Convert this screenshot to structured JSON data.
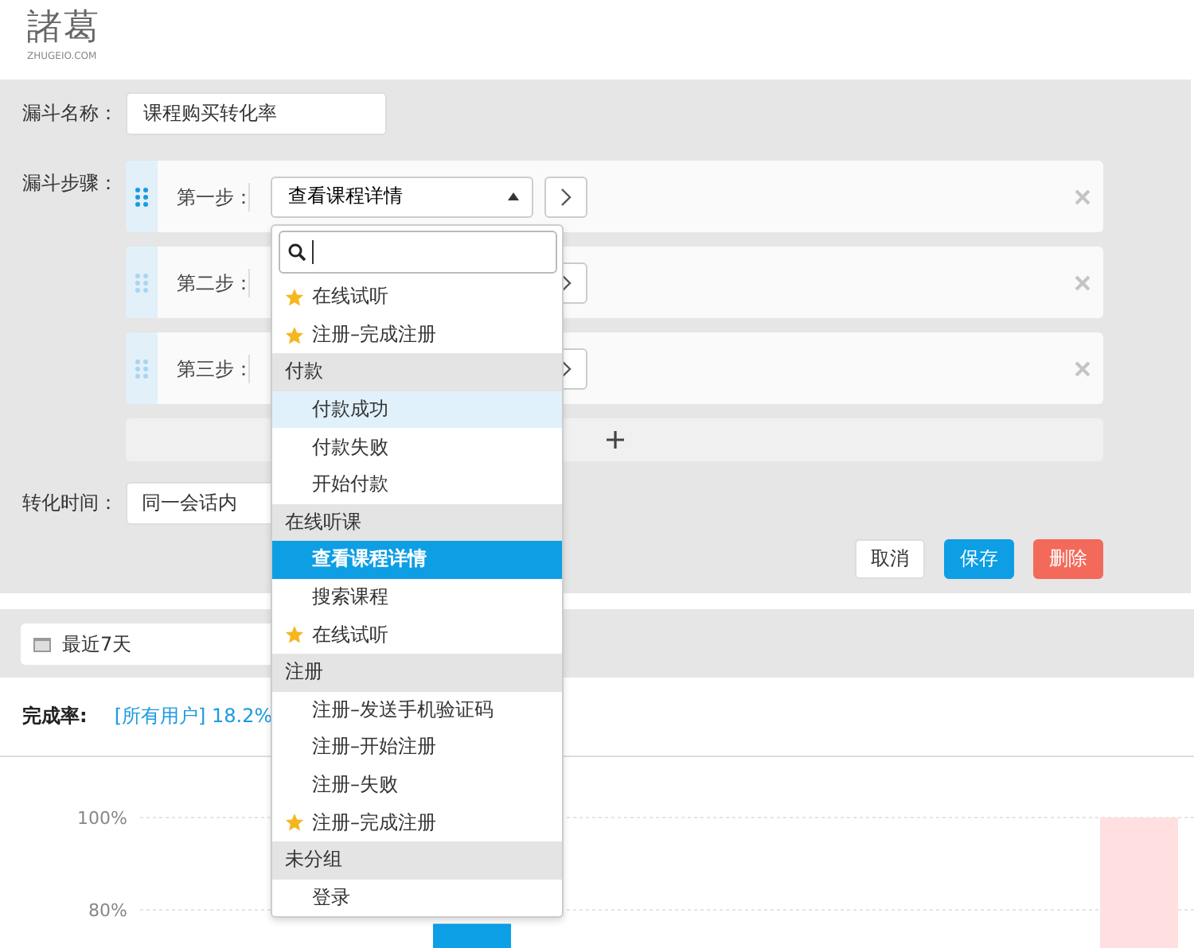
{
  "header": {
    "logo": "諸葛",
    "logo_caption": "ZHUGEIO.COM"
  },
  "form": {
    "name_label": "漏斗名称：",
    "name_value": "课程购买转化率",
    "steps_label": "漏斗步骤：",
    "steps": [
      {
        "label": "第一步：",
        "active": true,
        "value": "查看课程详情",
        "open": true
      },
      {
        "label": "第二步：",
        "active": false
      },
      {
        "label": "第三步：",
        "active": false
      }
    ],
    "time_label": "转化时间：",
    "time_value": "同一会话内",
    "buttons": [
      {
        "label": "取消",
        "kind": "default"
      },
      {
        "label": "保存",
        "kind": "primary"
      },
      {
        "label": "删除",
        "kind": "danger"
      }
    ]
  },
  "dropdown": {
    "items": [
      {
        "kind": "option",
        "label": "在线试听",
        "starred": true,
        "selected": false,
        "hovered": false
      },
      {
        "kind": "option",
        "label": "注册–完成注册",
        "starred": true,
        "selected": false,
        "hovered": false
      },
      {
        "kind": "group",
        "label": "付款"
      },
      {
        "kind": "option",
        "label": "付款成功",
        "starred": false,
        "selected": false,
        "hovered": true
      },
      {
        "kind": "option",
        "label": "付款失败",
        "starred": false,
        "selected": false,
        "hovered": false
      },
      {
        "kind": "option",
        "label": "开始付款",
        "starred": false,
        "selected": false,
        "hovered": false
      },
      {
        "kind": "group",
        "label": "在线听课"
      },
      {
        "kind": "option",
        "label": "查看课程详情",
        "starred": false,
        "selected": true,
        "hovered": false
      },
      {
        "kind": "option",
        "label": "搜索课程",
        "starred": false,
        "selected": false,
        "hovered": false
      },
      {
        "kind": "option",
        "label": "在线试听",
        "starred": true,
        "selected": false,
        "hovered": false
      },
      {
        "kind": "group",
        "label": "注册"
      },
      {
        "kind": "option",
        "label": "注册–发送手机验证码",
        "starred": false,
        "selected": false,
        "hovered": false
      },
      {
        "kind": "option",
        "label": "注册–开始注册",
        "starred": false,
        "selected": false,
        "hovered": false
      },
      {
        "kind": "option",
        "label": "注册–失败",
        "starred": false,
        "selected": false,
        "hovered": false
      },
      {
        "kind": "option",
        "label": "注册–完成注册",
        "starred": true,
        "selected": false,
        "hovered": false
      },
      {
        "kind": "group",
        "label": "未分组"
      },
      {
        "kind": "option",
        "label": "登录",
        "starred": false,
        "selected": false,
        "hovered": false
      }
    ]
  },
  "results": {
    "date_range": "最近7天",
    "rate_label": "完成率:",
    "rate_value": "[所有用户] 18.2%",
    "chart_data": {
      "type": "bar",
      "ylim": [
        71.4,
        100
      ],
      "yticks": [
        {
          "value": 100,
          "label": "100%"
        },
        {
          "value": 80,
          "label": "80%"
        }
      ],
      "series": [
        {
          "color": "#0ea0e6",
          "values": [
            77,
            null
          ]
        },
        {
          "color": "#ffdfe0",
          "values": [
            null,
            100
          ]
        }
      ]
    }
  }
}
